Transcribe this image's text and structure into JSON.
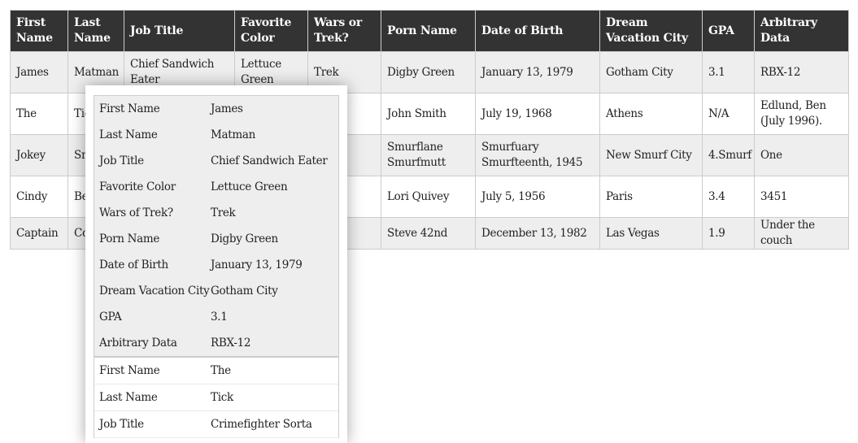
{
  "table": {
    "headers": [
      "First Name",
      "Last Name",
      "Job Title",
      "Favorite Color",
      "Wars or Trek?",
      "Porn Name",
      "Date of Birth",
      "Dream Vacation City",
      "GPA",
      "Arbitrary Data"
    ],
    "rows": [
      [
        "James",
        "Matman",
        "Chief Sandwich Eater",
        "Lettuce Green",
        "Trek",
        "Digby Green",
        "January 13, 1979",
        "Gotham City",
        "3.1",
        "RBX-12"
      ],
      [
        "The",
        "Tick",
        "Crimefighter Sorta",
        "",
        "",
        "John Smith",
        "July 19, 1968",
        "Athens",
        "N/A",
        "Edlund, Ben (July 1996)."
      ],
      [
        "Jokey",
        "Smurf",
        "",
        "",
        "",
        "Smurflane Smurfmutt",
        "Smurfuary Smurfteenth, 1945",
        "New Smurf City",
        "4.Smurf",
        "One"
      ],
      [
        "Cindy",
        "Beyler",
        "",
        "",
        "",
        "Lori Quivey",
        "July 5, 1956",
        "Paris",
        "3.4",
        "3451"
      ],
      [
        "Captain",
        "Cool",
        "",
        "",
        "",
        "Steve 42nd",
        "December 13, 1982",
        "Las Vegas",
        "1.9",
        "Under the couch"
      ]
    ]
  },
  "popup": {
    "records": [
      {
        "fields": [
          {
            "label": "First Name",
            "value": "James"
          },
          {
            "label": "Last Name",
            "value": "Matman"
          },
          {
            "label": "Job Title",
            "value": "Chief Sandwich Eater"
          },
          {
            "label": "Favorite Color",
            "value": "Lettuce Green"
          },
          {
            "label": "Wars of Trek?",
            "value": "Trek"
          },
          {
            "label": "Porn Name",
            "value": "Digby Green"
          },
          {
            "label": "Date of Birth",
            "value": "January 13, 1979"
          },
          {
            "label": "Dream Vacation City",
            "value": "Gotham City"
          },
          {
            "label": "GPA",
            "value": "3.1"
          },
          {
            "label": "Arbitrary Data",
            "value": "RBX-12"
          }
        ]
      },
      {
        "fields": [
          {
            "label": "First Name",
            "value": "The"
          },
          {
            "label": "Last Name",
            "value": "Tick"
          },
          {
            "label": "Job Title",
            "value": "Crimefighter Sorta"
          }
        ]
      }
    ]
  }
}
